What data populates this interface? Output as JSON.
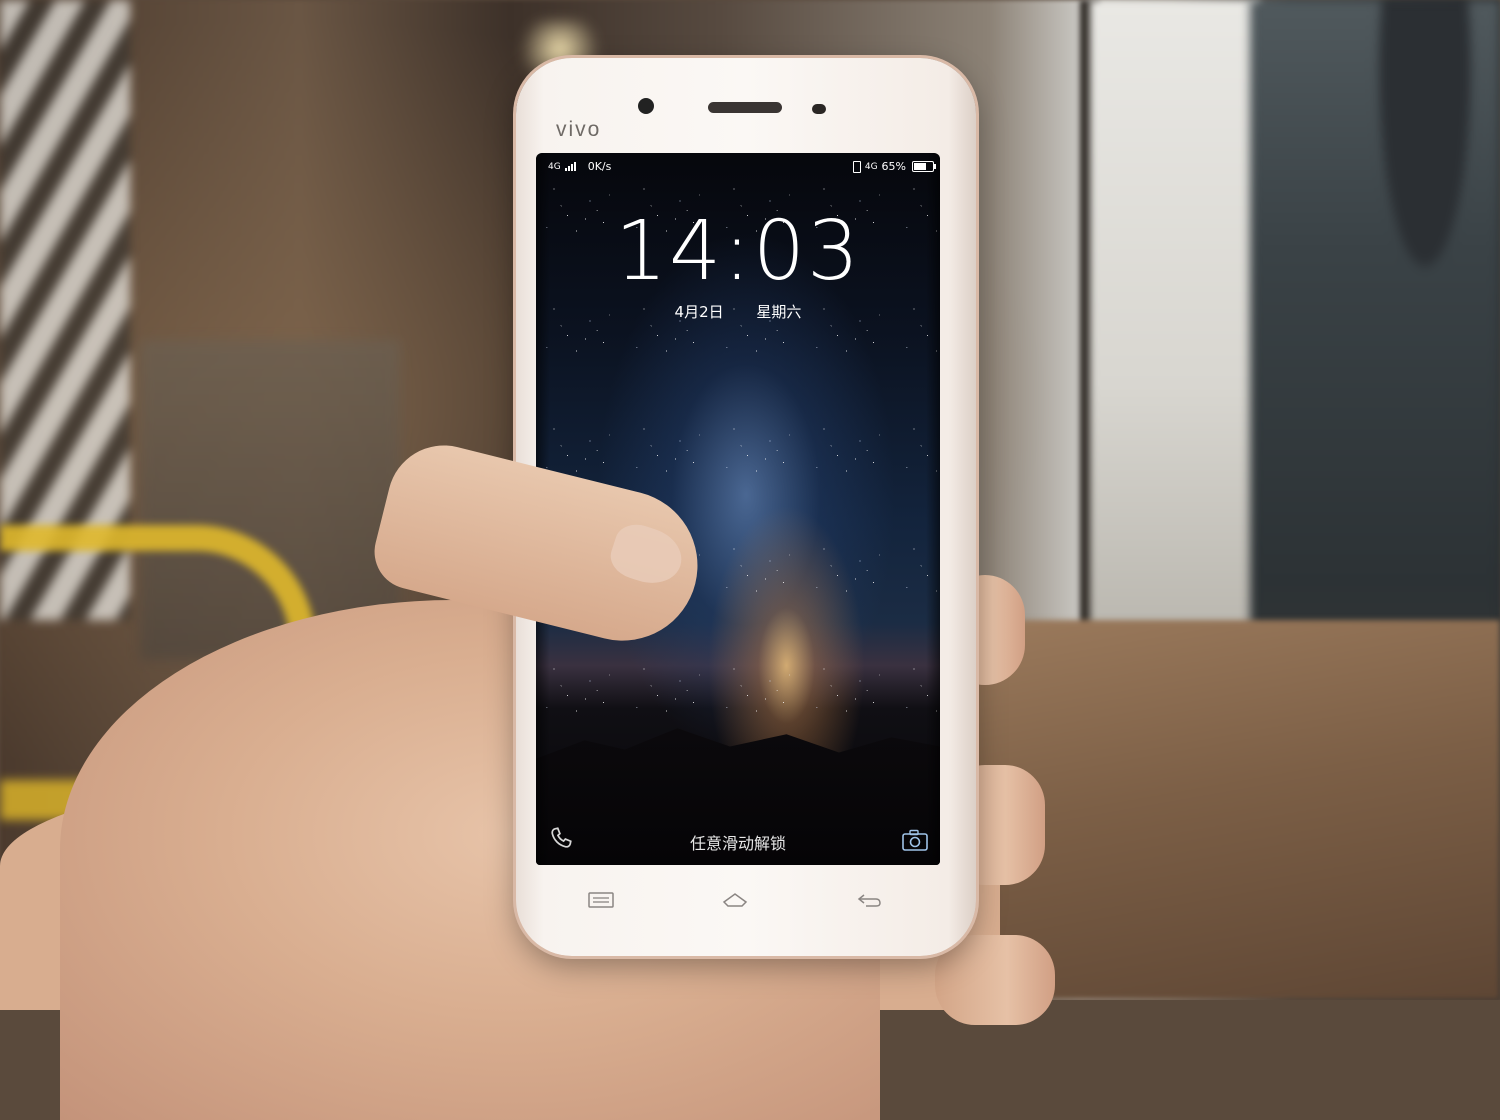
{
  "phone": {
    "brand": "vivo"
  },
  "status_bar": {
    "network_left": "4G",
    "speed": "0K/s",
    "network_right": "4G",
    "battery_text": "65%",
    "battery_level": 0.65
  },
  "lock_screen": {
    "time": "14:03",
    "date": "4月2日",
    "weekday": "星期六",
    "unlock_hint": "任意滑动解锁"
  },
  "icons": {
    "left_shortcut": "phone-icon",
    "right_shortcut": "camera-icon",
    "nav": [
      "menu-icon",
      "home-icon",
      "back-icon"
    ]
  },
  "colors": {
    "phone_body": "#fbf8f5",
    "phone_trim": "#d9b9a6"
  }
}
